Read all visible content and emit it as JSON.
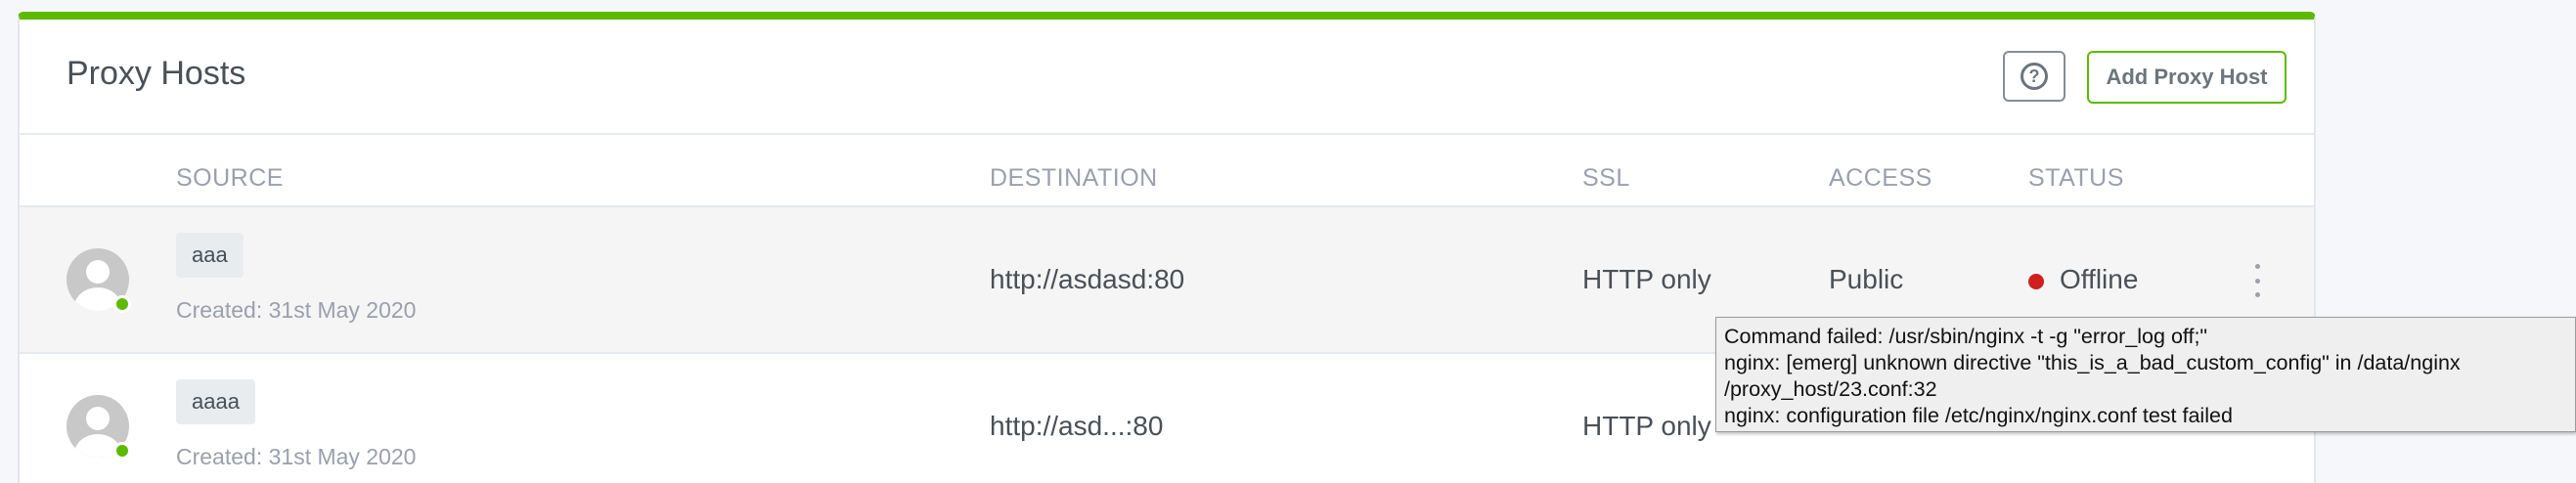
{
  "header": {
    "title": "Proxy Hosts",
    "help_icon": "question-circle-icon",
    "add_button_label": "Add Proxy Host"
  },
  "table": {
    "columns": [
      "SOURCE",
      "DESTINATION",
      "SSL",
      "ACCESS",
      "STATUS"
    ],
    "rows": [
      {
        "domain": "aaa",
        "created": "Created: 31st May 2020",
        "destination": "http://asdasd:80",
        "ssl": "HTTP only",
        "access": "Public",
        "status": "Offline"
      },
      {
        "domain": "aaaa",
        "created": "Created: 31st May 2020",
        "destination": "http://asd...:80",
        "ssl": "HTTP only"
      }
    ]
  },
  "tooltip": {
    "lines": [
      "Command failed: /usr/sbin/nginx -t -g \"error_log off;\"",
      "nginx: [emerg] unknown directive \"this_is_a_bad_custom_config\" in /data/nginx",
      "/proxy_host/23.conf:32",
      "nginx: configuration file /etc/nginx/nginx.conf test failed"
    ]
  },
  "colors": {
    "accent": "#5eba00",
    "offline": "#cd201f",
    "muted": "#9aa0ac"
  }
}
